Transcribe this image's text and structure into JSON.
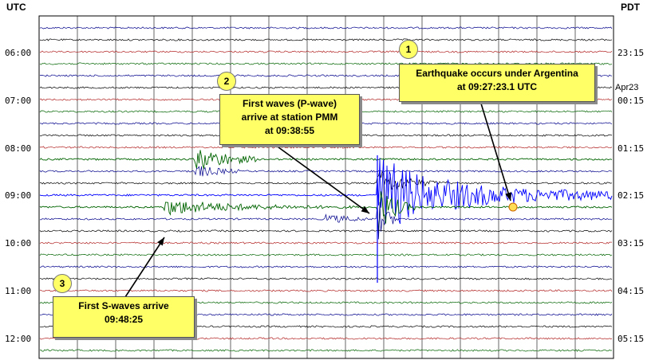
{
  "header": {
    "left_timezone": "UTC",
    "right_timezone": "PDT"
  },
  "utc_ticks": [
    "06:00",
    "07:00",
    "08:00",
    "09:00",
    "10:00",
    "11:00",
    "12:00"
  ],
  "pdt_ticks": [
    "23:15",
    "00:15",
    "01:15",
    "02:15",
    "03:15",
    "04:15",
    "05:15"
  ],
  "date_marker": "Apr23",
  "trace_colors": [
    "#00008b",
    "#000000",
    "#b22222",
    "#006400"
  ],
  "annotations": [
    {
      "number": "1",
      "lines": [
        "Earthquake occurs under Argentina",
        "at 09:27:23.1 UTC"
      ]
    },
    {
      "number": "2",
      "lines": [
        "First waves (P-wave)",
        "arrive at station PMM",
        "at 09:38:55"
      ]
    },
    {
      "number": "3",
      "lines": [
        "First S-waves arrive",
        "09:48:25"
      ]
    }
  ]
}
